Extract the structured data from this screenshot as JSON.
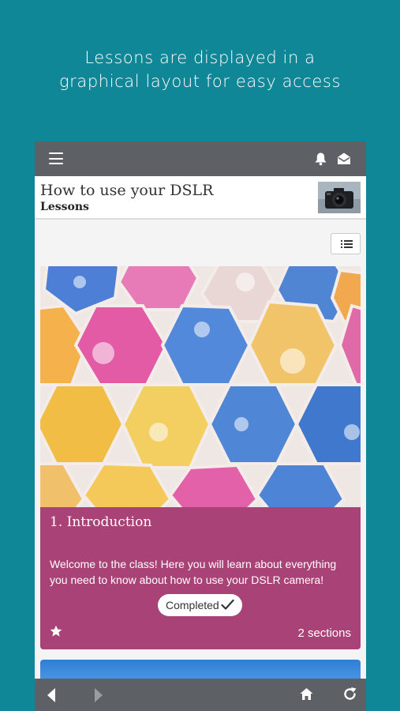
{
  "promo": {
    "line1": "Lessons are displayed in a",
    "line2": "graphical layout for easy access"
  },
  "topbar": {
    "menu_icon": "hamburger-icon",
    "notification_icon": "bell-icon",
    "messages_icon": "envelope-open-icon"
  },
  "header": {
    "title": "How to use your DSLR",
    "subtitle": "Lessons",
    "thumbnail": "camera-thumbnail"
  },
  "view_toggle": {
    "icon": "list-view-icon"
  },
  "lesson_card": {
    "title": "1. Introduction",
    "description": "Welcome to the class! Here you will learn about everything you need to know about how to use your DSLR camera!",
    "status": "Completed",
    "status_icon": "checkmark-icon",
    "favorite_icon": "star-icon",
    "sections": "2 sections",
    "color": "#a94277"
  },
  "bottombar": {
    "back_icon": "triangle-left-icon",
    "forward_icon": "triangle-right-icon",
    "home_icon": "home-icon",
    "refresh_icon": "refresh-icon"
  },
  "colors": {
    "background": "#0f8796",
    "toolbar": "#5d6064",
    "card": "#a94277"
  }
}
